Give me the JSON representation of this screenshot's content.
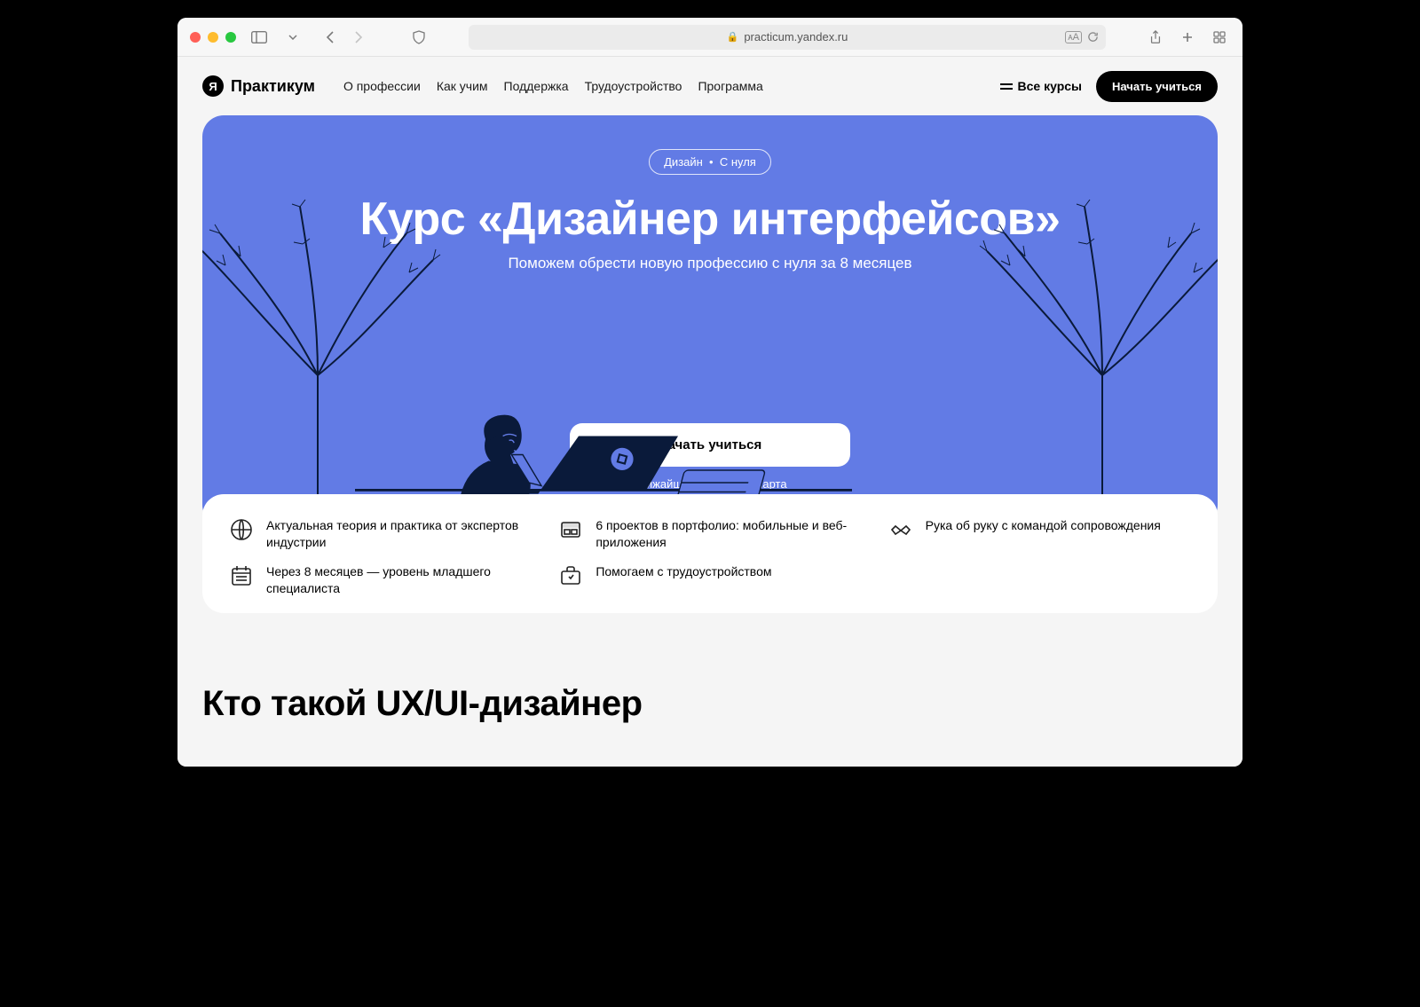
{
  "browser": {
    "url": "practicum.yandex.ru"
  },
  "header": {
    "logo_text": "Практикум",
    "logo_badge": "Я",
    "nav": [
      "О профессии",
      "Как учим",
      "Поддержка",
      "Трудоустройство",
      "Программа"
    ],
    "all_courses": "Все курсы",
    "cta": "Начать учиться"
  },
  "hero": {
    "chip_left": "Дизайн",
    "chip_right": "С нуля",
    "title": "Курс «Дизайнер интерфейсов»",
    "subtitle": "Поможем обрести новую профессию с нуля за 8 месяцев",
    "cta": "Начать учиться",
    "start_note": "ближайший старт — 9 марта"
  },
  "features": [
    "Актуальная теория и практика от экспертов индустрии",
    "6 проектов в портфолио: мобильные и веб-приложения",
    "Рука об руку с командой сопровождения",
    "Через 8 месяцев — уровень младшего специалиста",
    "Помогаем с трудоустройством"
  ],
  "section2_heading": "Кто такой UX/UI-дизайнер"
}
